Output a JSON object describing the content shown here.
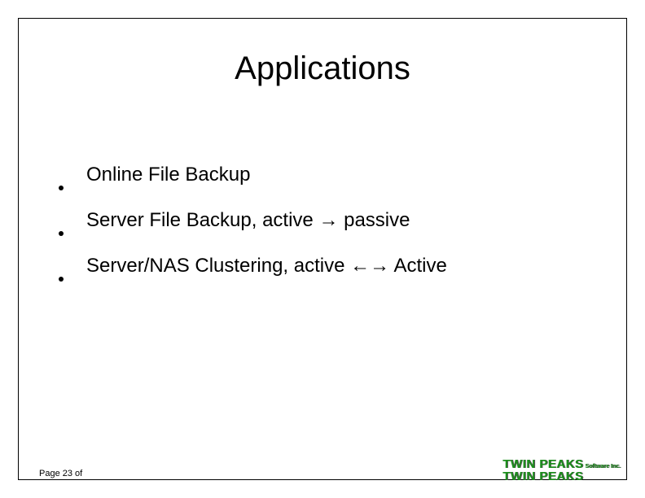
{
  "title": "Applications",
  "bullets": [
    "Online File Backup",
    "Server File Backup, active → passive",
    "Server/NAS Clustering, active ←→ Active"
  ],
  "footer": {
    "page_label": "Page 23 of"
  },
  "brand": {
    "line1": "TWIN PEAKS",
    "line1_sub": "Software Inc.",
    "line2": "TWIN PEAKS"
  }
}
